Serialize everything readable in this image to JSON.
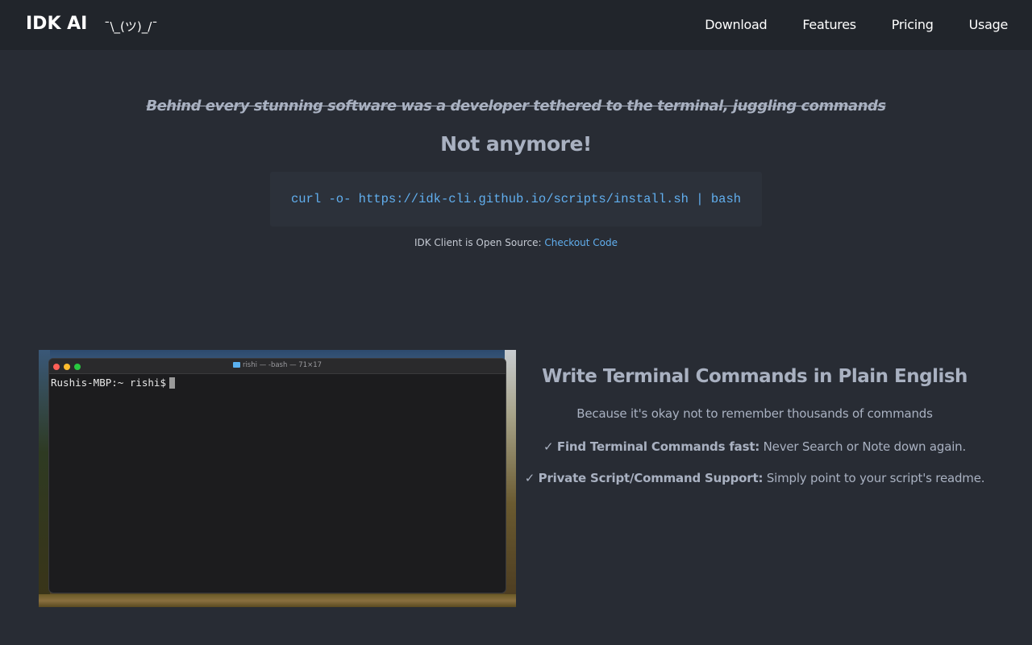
{
  "navbar": {
    "brand": "IDK AI",
    "shrug": "¯\\_(ツ)_/¯",
    "links": [
      "Download",
      "Features",
      "Pricing",
      "Usage"
    ]
  },
  "hero": {
    "strikethrough": "Behind every stunning software was a developer tethered to the terminal, juggling commands",
    "title": "Not anymore!",
    "install_command": "curl -o- https://idk-cli.github.io/scripts/install.sh | bash",
    "oss_text": "IDK Client is Open Source: ",
    "oss_link": "Checkout Code"
  },
  "terminal": {
    "window_title": "rishi — -bash — 71×17",
    "prompt": "Rushis-MBP:~ rishi$"
  },
  "feature": {
    "title": "Write Terminal Commands in Plain English",
    "subtitle": "Because it's okay not to remember thousands of commands",
    "items": [
      {
        "check": "✓",
        "bold": "Find Terminal Commands fast:",
        "text": " Never Search or Note down again."
      },
      {
        "check": "✓",
        "bold": "Private Script/Command Support:",
        "text": " Simply point to your script's readme."
      }
    ]
  },
  "colors": {
    "background": "#282c34",
    "navbar": "#21252b",
    "text": "#a9b1c1",
    "link": "#61afef",
    "code_bg": "#2c313a"
  }
}
